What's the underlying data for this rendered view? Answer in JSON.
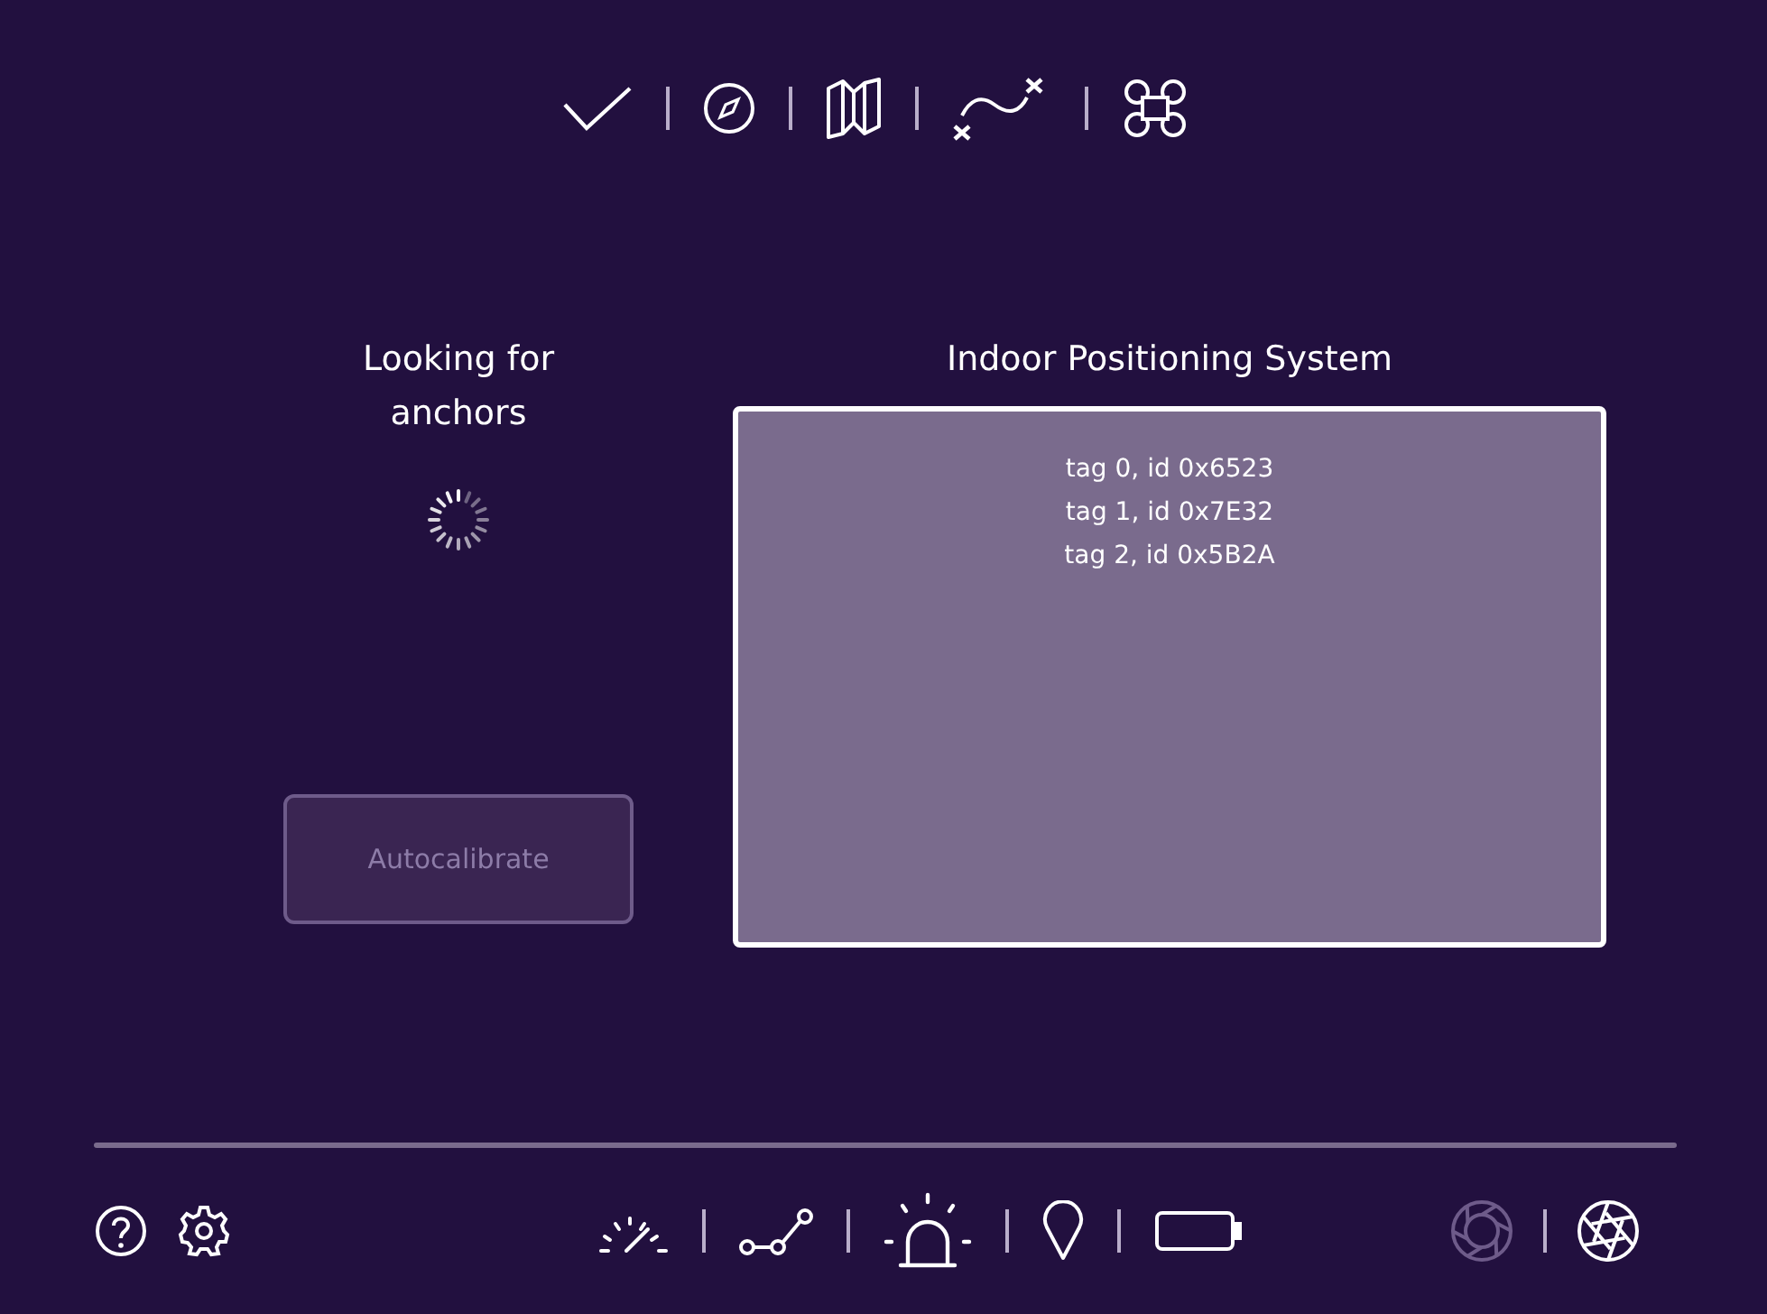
{
  "status": {
    "text": "Looking for anchors"
  },
  "autocalibrate": {
    "label": "Autocalibrate",
    "disabled": true
  },
  "ips": {
    "title": "Indoor Positioning System",
    "tags": [
      "tag 0, id 0x6523",
      "tag 1, id 0x7E32",
      "tag 2,  id 0x5B2A"
    ]
  },
  "camera_buttons": [
    {
      "kind": "aperture",
      "disabled": true
    },
    {
      "kind": "shutter",
      "disabled": false
    }
  ]
}
